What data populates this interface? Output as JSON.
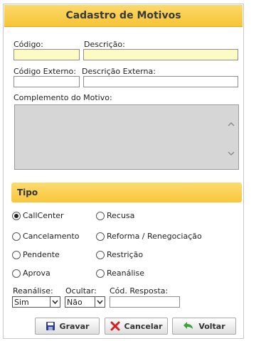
{
  "window": {
    "title": "Cadastro de Motivos"
  },
  "fields": {
    "codigo_label": "Código:",
    "descricao_label": "Descrição:",
    "codigo_externo_label": "Código Externo:",
    "descricao_externa_label": "Descrição Externa:",
    "complemento_label": "Complemento do Motivo:"
  },
  "tipo": {
    "title": "Tipo",
    "options": [
      "CallCenter",
      "Recusa",
      "Cancelamento",
      "Reforma / Renegociação",
      "Pendente",
      "Restrição",
      "Aprova",
      "Reanálise"
    ],
    "selected": "CallCenter"
  },
  "footer": {
    "reanalise_label": "Reanálise:",
    "reanalise_value": "Sim",
    "ocultar_label": "Ocultar:",
    "ocultar_value": "Não",
    "cod_resposta_label": "Cód. Resposta:"
  },
  "buttons": {
    "gravar": "Gravar",
    "cancelar": "Cancelar",
    "voltar": "Voltar"
  },
  "colors": {
    "accent": "#f8c63a",
    "required_field": "#fdfbc4"
  }
}
